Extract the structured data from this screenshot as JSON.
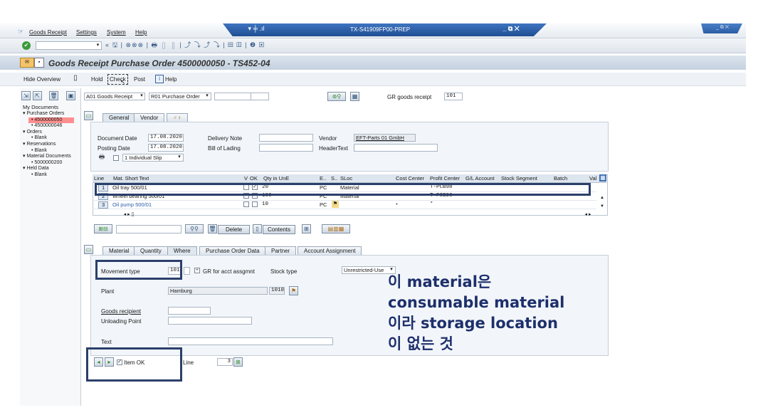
{
  "menu": {
    "items": [
      "Goods Receipt",
      "Settings",
      "System",
      "Help"
    ],
    "session_title": "TX-S41909FP00-PREP"
  },
  "title": "Goods Receipt Purchase Order 4500000050 - TS452-04",
  "app_toolbar": {
    "hide_overview": "Hide Overview",
    "hold": "Hold",
    "check": "Check",
    "post": "Post",
    "help": "Help"
  },
  "header_bar": {
    "action": "A01 Goods Receipt",
    "reference": "R01 Purchase Order",
    "gr_label": "GR goods receipt",
    "gr_code": "101"
  },
  "sidebar": {
    "title": "My Documents",
    "items": [
      {
        "label": "Purchase Orders",
        "level": 0
      },
      {
        "label": "4500000050",
        "level": 1,
        "selected": true
      },
      {
        "label": "4500000046",
        "level": 1
      },
      {
        "label": "Orders",
        "level": 0
      },
      {
        "label": "Blank",
        "level": 1
      },
      {
        "label": "Reservations",
        "level": 0
      },
      {
        "label": "Blank",
        "level": 1
      },
      {
        "label": "Material Documents",
        "level": 0
      },
      {
        "label": "5000000200",
        "level": 1
      },
      {
        "label": "Held Data",
        "level": 0
      },
      {
        "label": "Blank",
        "level": 1
      }
    ]
  },
  "header_tabs": [
    "General",
    "Vendor",
    "♂♀"
  ],
  "general": {
    "document_date_label": "Document Date",
    "document_date": "17.08.2020",
    "posting_date_label": "Posting Date",
    "posting_date": "17.08.2020",
    "delivery_note_label": "Delivery Note",
    "bill_of_lading_label": "Bill of Lading",
    "vendor_label": "Vendor",
    "vendor": "EFT-Parts 01 GmbH",
    "header_text_label": "HeaderText",
    "slip": "1 Individual Slip"
  },
  "items_table": {
    "columns": [
      "Line",
      "Mat. Short Text",
      "V",
      "OK",
      "Qty in UnE",
      "E..",
      "S..",
      "SLoc",
      "Cost Center",
      "Profit Center",
      "G/L Account",
      "Stock Segment",
      "Batch",
      "Val"
    ],
    "rows": [
      {
        "line": "1",
        "text": "Oil tray 500/01",
        "ok": "✓",
        "qty": "20",
        "unit": "PC",
        "sloc": "Material",
        "cost_center": "",
        "profit_center": "T-PCB98"
      },
      {
        "line": "2",
        "text": "Wheel bearing 500/01",
        "ok": "✓",
        "qty": "100",
        "unit": "PC",
        "sloc": "Material",
        "cost_center": "",
        "profit_center": "T-PCB98"
      },
      {
        "line": "3",
        "text": "Oil pump 500/01",
        "ok": "",
        "qty": "10",
        "unit": "PC",
        "sloc": "",
        "cost_center": "*",
        "profit_center": "*"
      }
    ],
    "delete_label": "Delete",
    "contents_label": "Contents"
  },
  "detail_tabs": [
    "Material",
    "Quantity",
    "Where",
    "Purchase Order Data",
    "Partner",
    "Account Assignment"
  ],
  "where": {
    "movement_type_label": "Movement type",
    "movement_type": "101",
    "gr_for_acct_label": "GR for acct assgmnt",
    "stock_type_label": "Stock type",
    "stock_type": "Unrestricted-Use",
    "plant_label": "Plant",
    "plant": "Hamburg",
    "plant_code": "1010",
    "goods_recipient_label": "Goods recipient",
    "unloading_point_label": "Unloading Point",
    "text_label": "Text"
  },
  "footer": {
    "item_ok_label": "Item OK",
    "line_label": "Line",
    "line_value": "3"
  },
  "annotation": {
    "lines": [
      "이 material은",
      "consumable material",
      "이라 storage location",
      "이 없는 것"
    ]
  },
  "colors": {
    "highlight": "#2b3f6b",
    "title_bar": "#c9d6e4",
    "window_bar": "#2c5fa6",
    "selected_row": "#ff8f8f"
  }
}
